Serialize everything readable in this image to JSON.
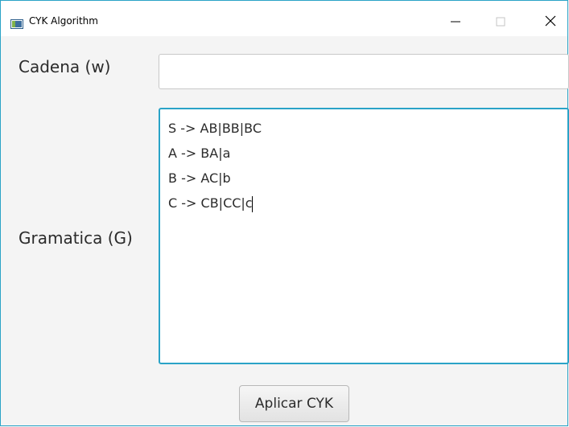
{
  "window": {
    "title": "CYK Algorithm",
    "accent_color": "#2aa3c7",
    "controls": [
      "minimize-icon",
      "maximize-icon",
      "close-icon"
    ]
  },
  "form": {
    "string_label": "Cadena (w)",
    "string_value": "",
    "grammar_label": "Gramatica (G)",
    "grammar_lines": [
      "S -> AB|BB|BC",
      "A -> BA|a",
      "B -> AC|b",
      "C -> CB|CC|c"
    ],
    "apply_button_label": "Aplicar CYK"
  }
}
